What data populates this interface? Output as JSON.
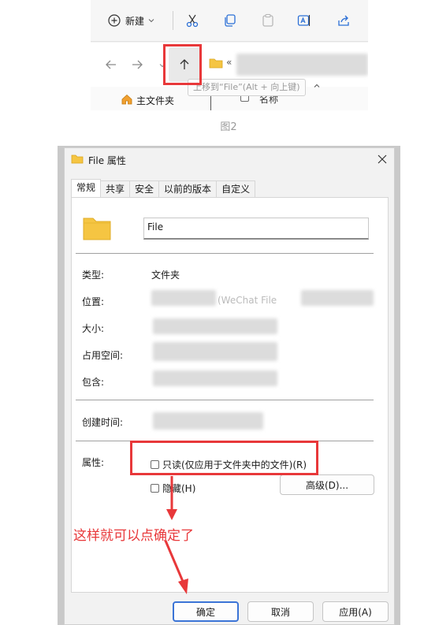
{
  "explorer": {
    "toolbar": {
      "new_label": "新建",
      "icons": [
        "plus-circle-icon",
        "chevron-down-icon",
        "cut-icon",
        "copy-icon",
        "paste-icon",
        "rename-icon",
        "share-icon"
      ]
    },
    "tooltip": "上移到“File”(Alt + 向上键)",
    "address_prefix": "«",
    "home_label": "主文件夹",
    "column_name": "名称"
  },
  "figure_caption": "图2",
  "dialog": {
    "title": "File 属性",
    "tabs": [
      "常规",
      "共享",
      "安全",
      "以前的版本",
      "自定义"
    ],
    "active_tab": "常规",
    "name_value": "File",
    "fields": {
      "type_label": "类型:",
      "type_value": "文件夹",
      "location_label": "位置:",
      "location_partial": "(WeChat File",
      "size_label": "大小:",
      "disk_label": "占用空间:",
      "contains_label": "包含:",
      "created_label": "创建时间:",
      "attributes_label": "属性:"
    },
    "readonly_label": "只读(仅应用于文件夹中的文件)(R)",
    "readonly_checked": false,
    "hidden_label": "隐藏(H)",
    "hidden_checked": false,
    "advanced_button": "高级(D)...",
    "ok_button": "确定",
    "cancel_button": "取消",
    "apply_button": "应用(A)"
  },
  "annotation_text": "这样就可以点确定了",
  "accent_colors": {
    "annotation_red": "#e8383a",
    "primary_blue": "#3b74d6",
    "folder_yellow": "#f5c542"
  }
}
